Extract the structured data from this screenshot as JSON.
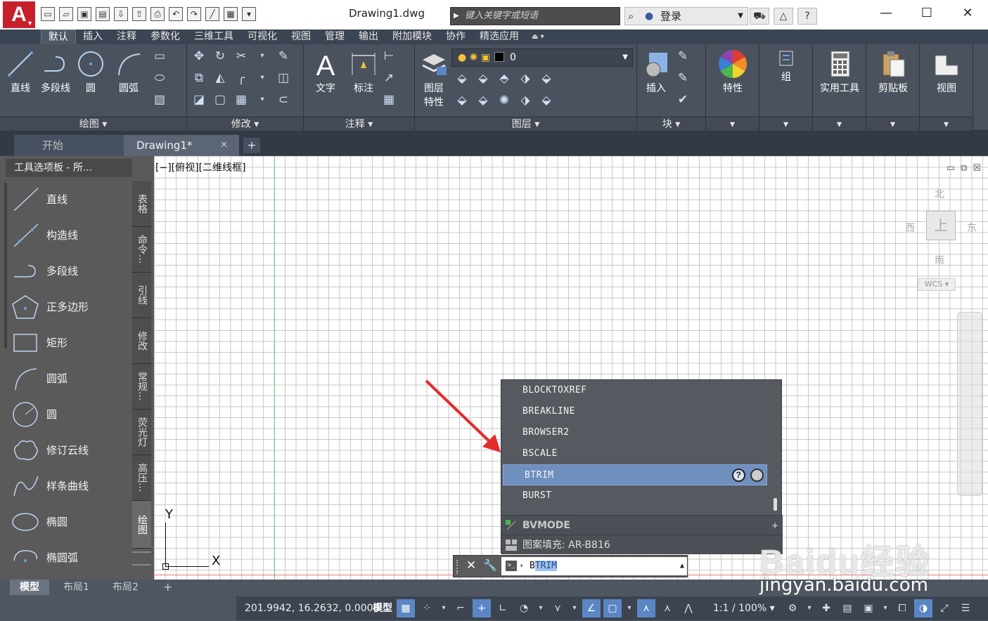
{
  "titlebar": {
    "app_logo": "A",
    "document_title": "Drawing1.dwg",
    "search_placeholder": "键入关键字或短语",
    "login_label": "登录",
    "help_label": "?"
  },
  "ribbon_tabs": [
    "默认",
    "插入",
    "注释",
    "参数化",
    "三维工具",
    "可视化",
    "视图",
    "管理",
    "输出",
    "附加模块",
    "协作",
    "精选应用"
  ],
  "ribbon": {
    "draw": {
      "title": "绘图",
      "line": "直线",
      "polyline": "多段线",
      "circle": "圆",
      "arc": "圆弧"
    },
    "modify": {
      "title": "修改"
    },
    "annotation": {
      "title": "注释",
      "text": "文字",
      "dimension": "标注"
    },
    "layers": {
      "title": "图层",
      "properties_line1": "图层",
      "properties_line2": "特性",
      "current_layer": "0"
    },
    "block": {
      "title": "块",
      "insert": "插入"
    },
    "properties": {
      "label": "特性"
    },
    "groups": {
      "label": "组"
    },
    "utilities": {
      "label": "实用工具"
    },
    "clipboard": {
      "label": "剪贴板"
    },
    "view": {
      "label": "视图"
    }
  },
  "file_tabs": {
    "start": "开始",
    "drawing": "Drawing1*"
  },
  "palette": {
    "title": "工具选项板 - 所...",
    "items": [
      "直线",
      "构造线",
      "多段线",
      "正多边形",
      "矩形",
      "圆弧",
      "圆",
      "修订云线",
      "样条曲线",
      "椭圆",
      "椭圆弧"
    ],
    "vertical_tabs": [
      "表格",
      "命令...",
      "引线",
      "修改",
      "常规...",
      "荧光灯",
      "高压...",
      "绘图"
    ]
  },
  "canvas": {
    "viewport_label": "[−][俯视][二维线框]",
    "viewcube": {
      "north": "北",
      "south": "南",
      "east": "东",
      "west": "西",
      "top": "上",
      "wcs": "WCS"
    },
    "ucs": {
      "x": "X",
      "y": "Y"
    }
  },
  "autocomplete": {
    "items": [
      "BLOCKTOXREF",
      "BREAKLINE",
      "BROWSER2",
      "BSCALE",
      "BTRIM",
      "BURST"
    ],
    "selected_index": 4,
    "sections": [
      "BVMODE",
      "图案填充: AR-B816"
    ]
  },
  "command_line": {
    "typed": "B",
    "suggested": "TRIM"
  },
  "layout_tabs": [
    "模型",
    "布局1",
    "布局2"
  ],
  "statusbar": {
    "coords": "201.9942, 16.2632, 0.0000",
    "model": "模型",
    "scale": "1:1 / 100%"
  },
  "watermark": {
    "logo": "Baidu经验",
    "url": "jingyan.baidu.com"
  }
}
